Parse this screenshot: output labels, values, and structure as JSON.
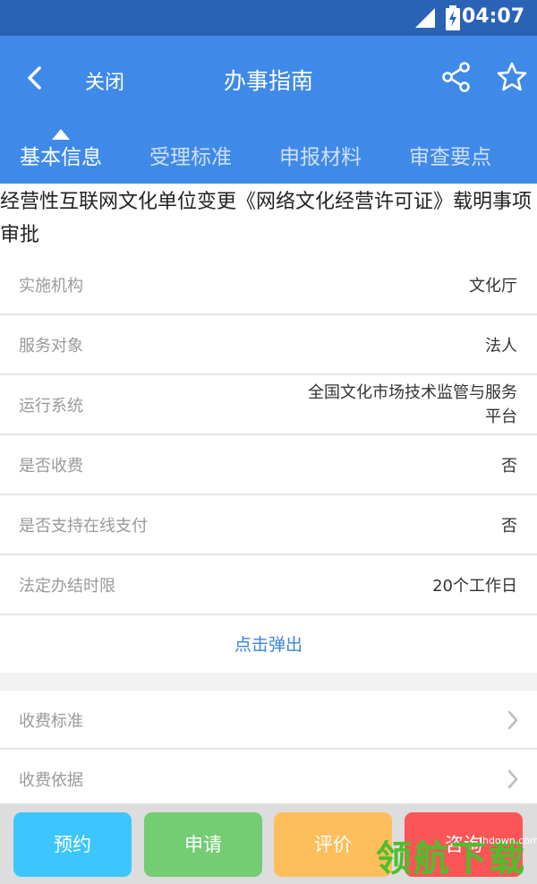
{
  "status_bar": {
    "time": "04:07"
  },
  "header": {
    "back_icon": "chevron-left-icon",
    "close_label": "关闭",
    "title": "办事指南",
    "share_icon": "share-icon",
    "favorite_icon": "star-icon",
    "bg_color": "#3f8ae8"
  },
  "tabs": [
    {
      "label": "基本信息",
      "active": true
    },
    {
      "label": "受理标准",
      "active": false
    },
    {
      "label": "申报材料",
      "active": false
    },
    {
      "label": "审查要点",
      "active": false
    }
  ],
  "item_title": "经营性互联网文化单位变更《网络文化经营许可证》载明事项审批",
  "info_rows": [
    {
      "label": "实施机构",
      "value": "文化厅"
    },
    {
      "label": "服务对象",
      "value": "法人"
    },
    {
      "label": "运行系统",
      "value": "全国文化市场技术监管与服务平台"
    },
    {
      "label": "是否收费",
      "value": "否"
    },
    {
      "label": "是否支持在线支付",
      "value": "否"
    },
    {
      "label": "法定办结时限",
      "value": "20个工作日"
    }
  ],
  "popup_link": "点击弹出",
  "link_rows": [
    {
      "label": "收费标准"
    },
    {
      "label": "收费依据"
    }
  ],
  "actions": [
    {
      "label": "预约",
      "color": "#3cc6ff"
    },
    {
      "label": "申请",
      "color": "#72cd73"
    },
    {
      "label": "评价",
      "color": "#ffbe5c"
    },
    {
      "label": "咨询",
      "color": "#fb5557"
    }
  ],
  "watermark": {
    "text": "领航下载",
    "url": "lhdown.com"
  }
}
